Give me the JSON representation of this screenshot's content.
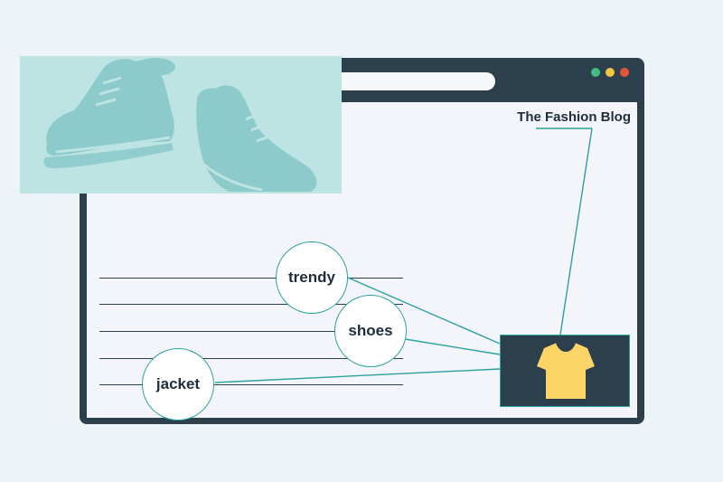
{
  "blog": {
    "title": "The Fashion Blog"
  },
  "keywords": [
    "trendy",
    "shoes",
    "jacket"
  ],
  "colors": {
    "background": "#edf4f7",
    "window_frame": "#2b3f4d",
    "page": "#f4f5fa",
    "hero": "#bde3e3",
    "shoe": "#8ccacb",
    "connector": "#2aa19c",
    "tshirt": "#fdd566",
    "dot_green": "#3fbf7f",
    "dot_yellow": "#f2c545",
    "dot_red": "#e5533d"
  },
  "icons": {
    "hero": "sneakers-illustration",
    "product": "tshirt-icon"
  }
}
